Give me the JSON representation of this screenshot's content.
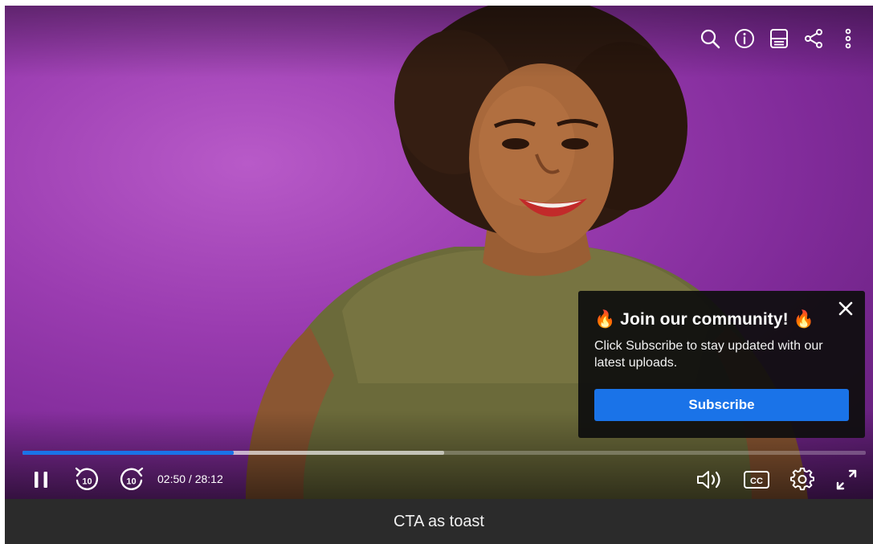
{
  "player": {
    "top_icons": [
      "search-icon",
      "info-icon",
      "transcript-icon",
      "share-icon",
      "more-vertical-icon"
    ],
    "progress": {
      "played_fraction": 0.25,
      "buffered_fraction": 0.5
    },
    "time": {
      "current": "02:50",
      "duration": "28:12",
      "display": "02:50 / 28:12"
    },
    "controls": {
      "left": [
        "pause-icon",
        "rewind-10-icon",
        "forward-10-icon"
      ],
      "right": [
        "volume-icon",
        "closed-captions-icon",
        "settings-icon",
        "fullscreen-icon"
      ],
      "rewind_label": "10",
      "forward_label": "10",
      "cc_label": "CC"
    },
    "accent_color": "#1a73e8"
  },
  "toast": {
    "title": "🔥 Join our community! 🔥",
    "body": "Click Subscribe to stay updated with our latest uploads.",
    "button_label": "Subscribe",
    "close_icon": "close-icon"
  },
  "caption": "CTA as toast"
}
